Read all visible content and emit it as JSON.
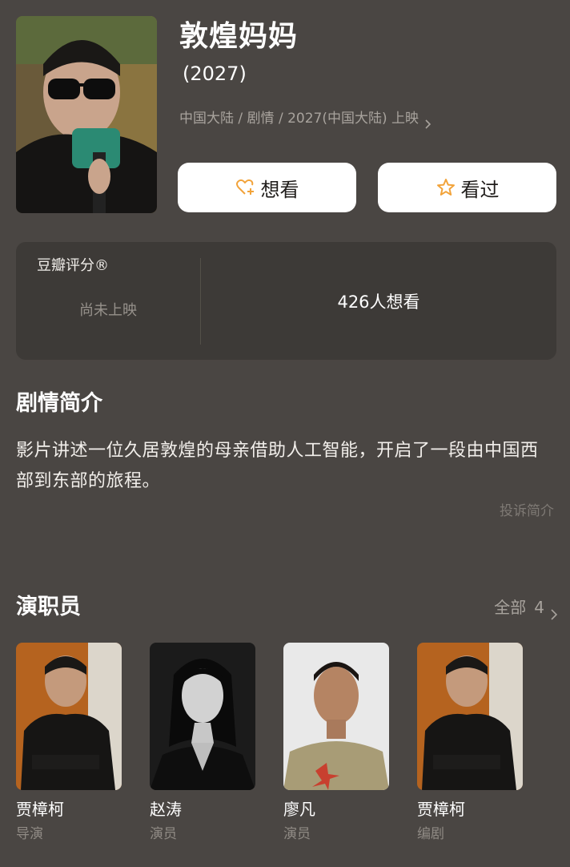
{
  "movie": {
    "title": "敦煌妈妈",
    "year": "(2027)",
    "meta": "中国大陆 / 剧情 / 2027(中国大陆) 上映"
  },
  "actions": {
    "want_label": "想看",
    "seen_label": "看过"
  },
  "rating": {
    "label": "豆瓣评分®",
    "status": "尚未上映",
    "want_count": "426人想看"
  },
  "synopsis": {
    "title": "剧情简介",
    "text": "影片讲述一位久居敦煌的母亲借助人工智能，开启了一段由中国西部到东部的旅程。",
    "report_label": "投诉简介"
  },
  "cast": {
    "title": "演职员",
    "all_label": "全部",
    "all_count": "4",
    "members": [
      {
        "name": "贾樟柯",
        "role": "导演"
      },
      {
        "name": "赵涛",
        "role": "演员"
      },
      {
        "name": "廖凡",
        "role": "演员"
      },
      {
        "name": "贾樟柯",
        "role": "编剧"
      }
    ]
  },
  "colors": {
    "background": "#4a4643",
    "card": "#3d3a37",
    "accent_icon": "#f2a33a"
  }
}
